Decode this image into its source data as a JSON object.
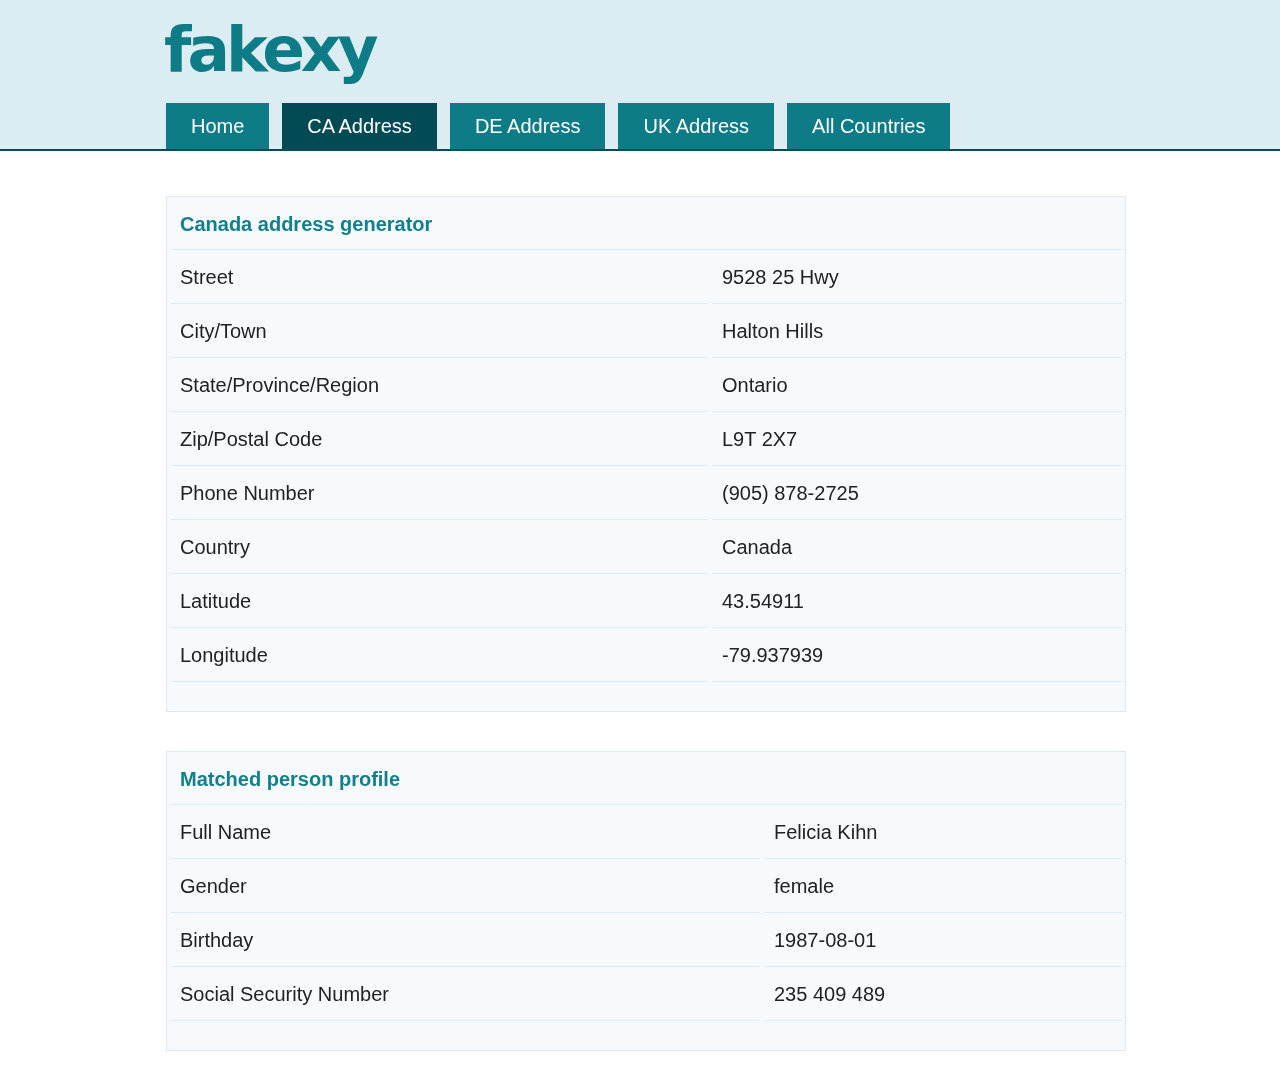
{
  "site": {
    "logo": "fakexy"
  },
  "nav": [
    {
      "label": "Home",
      "selected": false
    },
    {
      "label": "CA Address",
      "selected": true
    },
    {
      "label": "DE Address",
      "selected": false
    },
    {
      "label": "UK Address",
      "selected": false
    },
    {
      "label": "All Countries",
      "selected": false
    }
  ],
  "sections": [
    {
      "title": "Canada address generator",
      "rows": [
        {
          "label": "Street",
          "value": "9528 25 Hwy"
        },
        {
          "label": "City/Town",
          "value": "Halton Hills"
        },
        {
          "label": "State/Province/Region",
          "value": "Ontario"
        },
        {
          "label": "Zip/Postal Code",
          "value": "L9T 2X7"
        },
        {
          "label": "Phone Number",
          "value": "(905) 878-2725"
        },
        {
          "label": "Country",
          "value": "Canada"
        },
        {
          "label": "Latitude",
          "value": "43.54911"
        },
        {
          "label": "Longitude",
          "value": "-79.937939"
        }
      ]
    },
    {
      "title": "Matched person profile",
      "rows": [
        {
          "label": "Full Name",
          "value": "Felicia Kihn"
        },
        {
          "label": "Gender",
          "value": "female"
        },
        {
          "label": "Birthday",
          "value": "1987-08-01"
        },
        {
          "label": "Social Security Number",
          "value": "235 409 489"
        }
      ]
    }
  ]
}
